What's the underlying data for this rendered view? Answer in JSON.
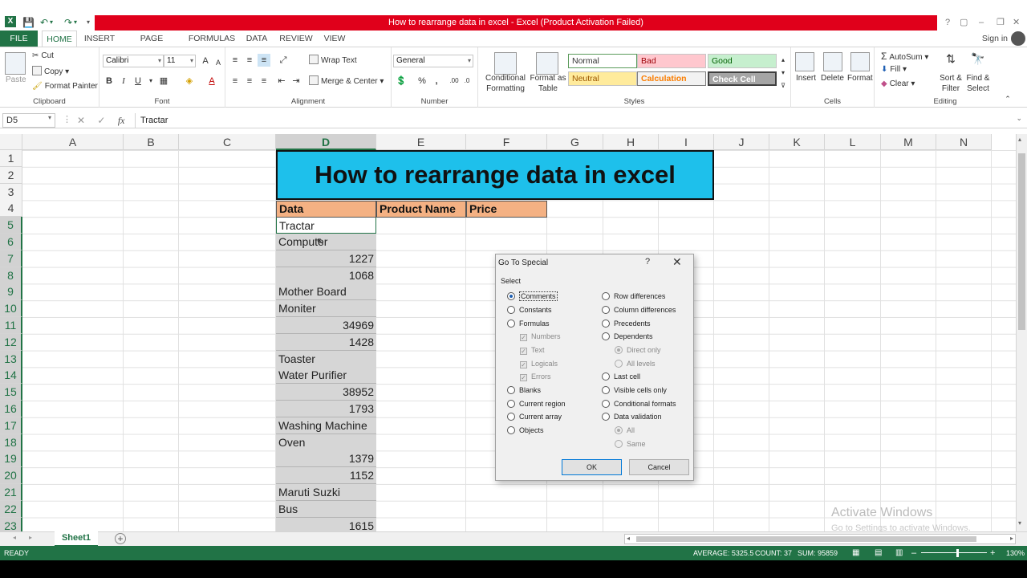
{
  "window": {
    "title": "How to rearrange data in excel -  Excel (Product Activation Failed)",
    "controls": [
      "?",
      "▢",
      "–",
      "❐",
      "✕"
    ]
  },
  "tabs": [
    "FILE",
    "HOME",
    "INSERT",
    "PAGE LAYOUT",
    "FORMULAS",
    "DATA",
    "REVIEW",
    "VIEW"
  ],
  "signin": "Sign in",
  "ribbon": {
    "clipboard": {
      "label": "Clipboard",
      "paste": "Paste",
      "cut": "Cut",
      "copy": "Copy",
      "format_painter": "Format Painter"
    },
    "font": {
      "label": "Font",
      "name": "Calibri",
      "size": "11",
      "bold": "B",
      "italic": "I",
      "underline": "U"
    },
    "alignment": {
      "label": "Alignment",
      "wrap": "Wrap Text",
      "merge": "Merge & Center"
    },
    "number": {
      "label": "Number",
      "format": "General",
      "percent": "%",
      "comma": ","
    },
    "styles": {
      "label": "Styles",
      "conditional": "Conditional Formatting",
      "format_table": "Format as Table",
      "normal": "Normal",
      "bad": "Bad",
      "good": "Good",
      "neutral": "Neutral",
      "calculation": "Calculation",
      "check": "Check Cell"
    },
    "cells": {
      "label": "Cells",
      "insert": "Insert",
      "delete": "Delete",
      "format": "Format"
    },
    "editing": {
      "label": "Editing",
      "autosum": "AutoSum",
      "fill": "Fill",
      "clear": "Clear",
      "sort": "Sort & Filter",
      "find": "Find & Select"
    }
  },
  "formula_bar": {
    "namebox": "D5",
    "fx": "fx",
    "value": "Tractar"
  },
  "columns": [
    "A",
    "B",
    "C",
    "D",
    "E",
    "F",
    "G",
    "H",
    "I",
    "J",
    "K",
    "L",
    "M",
    "N"
  ],
  "rows": [
    "1",
    "2",
    "3",
    "4",
    "5",
    "6",
    "7",
    "8",
    "9",
    "10",
    "11",
    "12",
    "13",
    "14",
    "15",
    "16",
    "17",
    "18",
    "19",
    "20",
    "21",
    "22",
    "23"
  ],
  "sheet": {
    "banner": "How to rearrange data in excel",
    "headers": [
      "Data",
      "Product Name",
      "Price"
    ],
    "data": [
      "Tractar",
      "Computer",
      "1227",
      "1068",
      "Mother Board",
      "Moniter",
      "34969",
      "1428",
      "Toaster",
      "Water Purifier",
      "38952",
      "1793",
      "Washing Machine",
      "Oven",
      "1379",
      "1152",
      "Maruti Suzki",
      "Bus",
      "1615"
    ]
  },
  "dialog": {
    "title": "Go To Special",
    "help": "?",
    "close": "✕",
    "select_label": "Select",
    "left": [
      "Comments",
      "Constants",
      "Formulas",
      "Numbers",
      "Text",
      "Logicals",
      "Errors",
      "Blanks",
      "Current region",
      "Current array",
      "Objects"
    ],
    "right": [
      "Row differences",
      "Column differences",
      "Precedents",
      "Dependents",
      "Direct only",
      "All levels",
      "Last cell",
      "Visible cells only",
      "Conditional formats",
      "Data validation",
      "All",
      "Same"
    ],
    "ok": "OK",
    "cancel": "Cancel"
  },
  "sheet_tab": "Sheet1",
  "status": {
    "ready": "READY",
    "average": "AVERAGE: 5325.5",
    "count": "COUNT: 37",
    "sum": "SUM: 95859",
    "zoom": "130%"
  },
  "watermark": {
    "line1": "Activate Windows",
    "line2": "Go to Settings to activate Windows."
  },
  "colors": {
    "excel_green": "#217346",
    "title_red": "#e0001b",
    "banner_blue": "#1ec0eb",
    "header_orange": "#f4b183"
  }
}
